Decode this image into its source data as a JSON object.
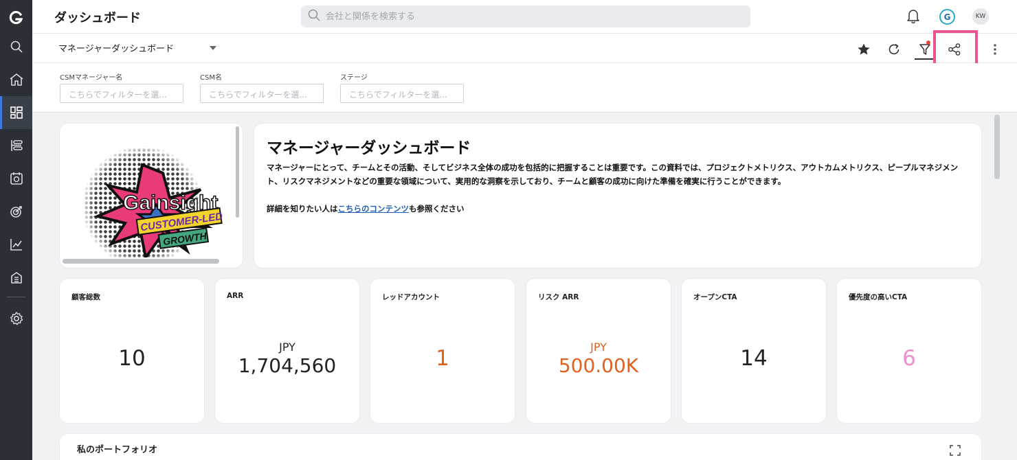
{
  "header": {
    "title": "ダッシュボード",
    "search_placeholder": "会社と関係を検索する",
    "avatar_initials": "KW",
    "account_letter": "G"
  },
  "nav": {
    "logo": "G",
    "items": [
      "search-icon",
      "home-icon",
      "dashboard-icon",
      "timeline-icon",
      "calendar-icon",
      "target-icon",
      "analytics-icon",
      "building-icon",
      "settings-icon"
    ]
  },
  "toolbar": {
    "dashboard_name": "マネージャーダッシュボード"
  },
  "filters": [
    {
      "label": "CSMマネージャー名",
      "placeholder": "こちらでフィルターを選..."
    },
    {
      "label": "CSM名",
      "placeholder": "こちらでフィルターを選..."
    },
    {
      "label": "ステージ",
      "placeholder": "こちらでフィルターを選..."
    }
  ],
  "intro": {
    "title": "マネージャーダッシュボード",
    "text1": "マネージャーにとって、チームとその活動、そしてビジネス全体の成功を包括的に把握することは重要です。この資料では、プロジェクトメトリクス、アウトカムメトリクス、ピープルマネジメント、リスクマネジメントなどの重要な領域について、実用的な洞察を示しており、チームと顧客の成功に向けた準備を確実に行うことができます。",
    "text2_before": "詳細を知りたい人は",
    "text2_link": "こちらのコンテンツ",
    "text2_after": "も参照ください"
  },
  "logo_image": {
    "brand": "Gainsight",
    "tag1": "CUSTOMER-LED",
    "tag2": "GROWTH"
  },
  "kpis": [
    {
      "title": "顧客総数",
      "unit": "",
      "value": "10",
      "color": "#222222"
    },
    {
      "title": "ARR",
      "unit": "JPY",
      "value": "1,704,560",
      "color": "#222222"
    },
    {
      "title": "レッドアカウント",
      "unit": "",
      "value": "1",
      "color": "#e0621f"
    },
    {
      "title": "リスク ARR",
      "unit": "JPY",
      "value": "500.00K",
      "color": "#e0621f"
    },
    {
      "title": "オープンCTA",
      "unit": "",
      "value": "14",
      "color": "#222222"
    },
    {
      "title": "優先度の高いCTA",
      "unit": "",
      "value": "6",
      "color": "#ee8fd0"
    }
  ],
  "portfolio": {
    "title": "私のポートフォリオ"
  }
}
